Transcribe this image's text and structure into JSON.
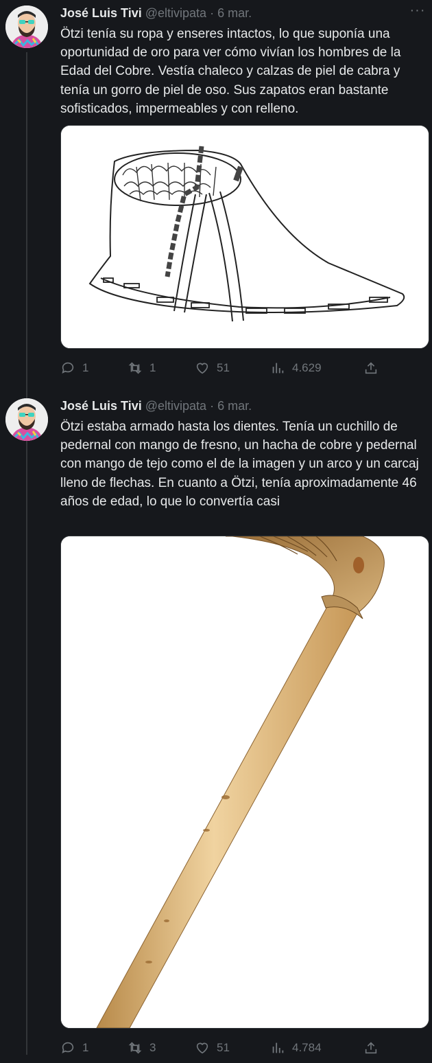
{
  "tweets": [
    {
      "author_name": "José Luis Tivi",
      "handle": "@eltivipata",
      "separator": "·",
      "date": "6 mar.",
      "text": "Ötzi tenía su ropa y enseres intactos, lo que suponía una oportunidad de oro para ver cómo vivían los hombres de la Edad del Cobre. Vestía chaleco y calzas de piel de cabra y tenía un gorro de piel de oso. Sus zapatos eran bastante sofisticados, impermeables y con relleno.",
      "media_icon": "shoe-drawing-image",
      "stats": {
        "replies": "1",
        "retweets": "1",
        "likes": "51",
        "views": "4.629"
      }
    },
    {
      "author_name": "José Luis Tivi",
      "handle": "@eltivipata",
      "separator": "·",
      "date": "6 mar.",
      "text": "Ötzi estaba armado hasta los dientes. Tenía un cuchillo de pedernal con mango de fresno, un hacha de cobre y pedernal con mango de tejo como el de la imagen y un arco y un carcaj lleno de flechas. En cuanto a Ötzi, tenía aproximadamente 46 años de edad, lo que lo convertía casi",
      "media_icon": "axe-handle-image",
      "stats": {
        "replies": "1",
        "retweets": "3",
        "likes": "51",
        "views": "4.784"
      }
    }
  ],
  "colors": {
    "background": "#16181c",
    "text": "#e7e9ea",
    "muted": "#71767b",
    "thread_line": "#333639"
  }
}
